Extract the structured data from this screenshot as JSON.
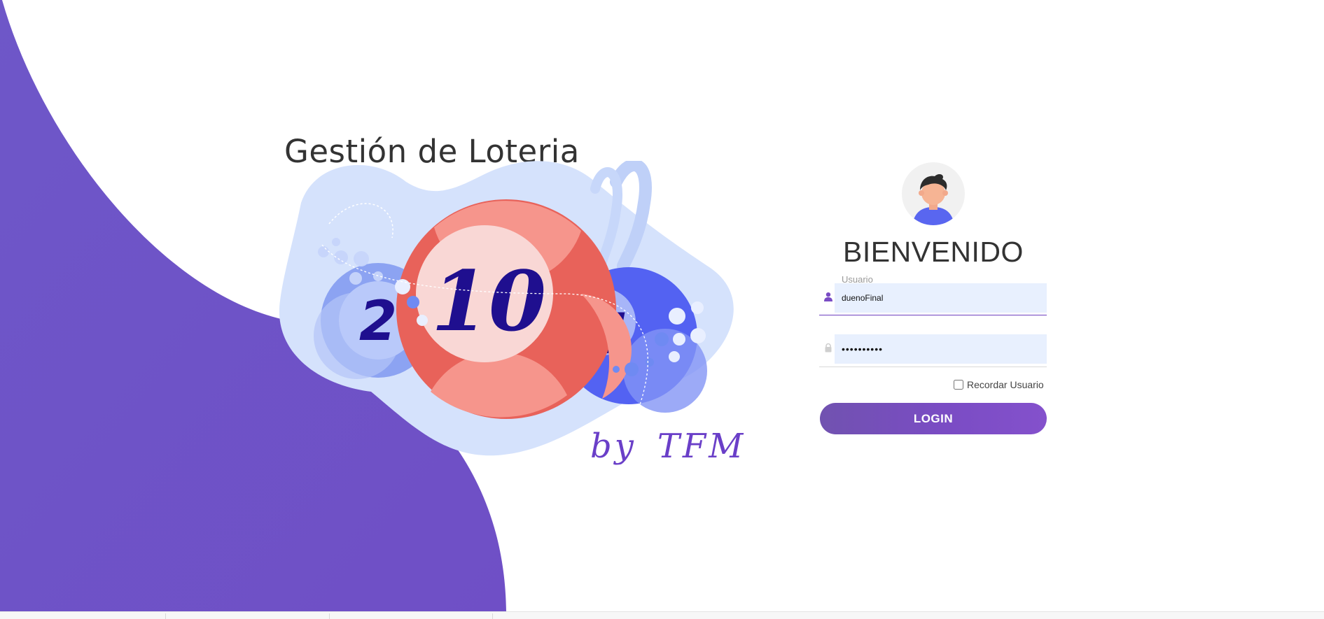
{
  "app": {
    "title": "Gestión de Loteria",
    "byline_prefix": "by",
    "byline_name": "TFM"
  },
  "illustration": {
    "balls": [
      {
        "number": "2",
        "color": "#8da4f2"
      },
      {
        "number": "10",
        "color": "#e8625a"
      },
      {
        "number": "1",
        "color": "#5261f0"
      }
    ],
    "number_color": "#1f0f8f"
  },
  "login": {
    "welcome": "BIENVENIDO",
    "avatar_icon": "user-avatar-icon",
    "username": {
      "label": "Usuario",
      "value": "duenoFinal",
      "icon": "user-icon"
    },
    "password": {
      "value": "••••••••••",
      "icon": "lock-icon"
    },
    "remember_label": "Recordar Usuario",
    "remember_checked": false,
    "button_label": "LOGIN"
  },
  "colors": {
    "accent": "#7152c8",
    "wave": "#6f55c8",
    "input_bg": "#e8f0fe",
    "text": "#333333"
  }
}
